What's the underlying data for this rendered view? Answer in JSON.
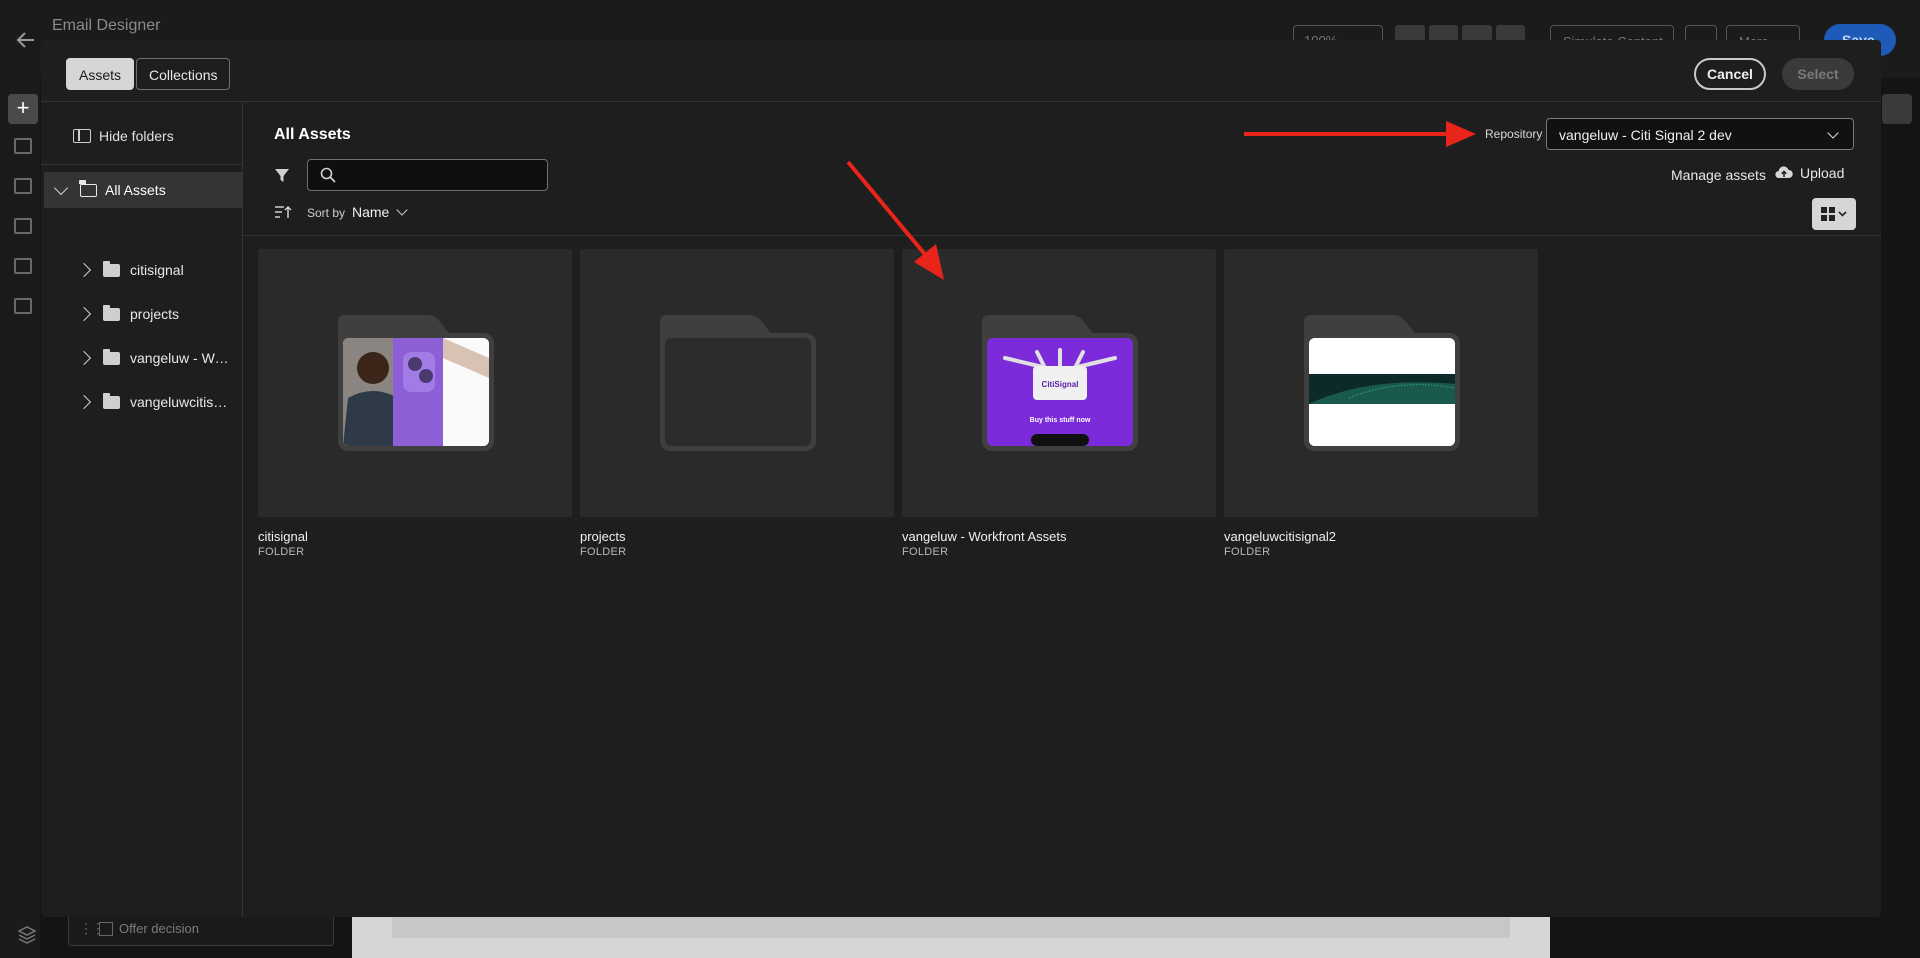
{
  "app": {
    "title": "Email Designer",
    "zoom": "100%",
    "simulate_label": "Simulate Content",
    "more_label": "More",
    "save_label": "Save",
    "offer_decision_label": "Offer decision"
  },
  "dialog": {
    "tabs": [
      {
        "label": "Assets",
        "active": true
      },
      {
        "label": "Collections",
        "active": false
      }
    ],
    "cancel_label": "Cancel",
    "select_label": "Select",
    "sidebar": {
      "hide_folders_label": "Hide folders",
      "root": {
        "label": "All Assets",
        "expanded": true
      },
      "items": [
        {
          "label": "citisignal"
        },
        {
          "label": "projects"
        },
        {
          "label": "vangeluw - Workfront Assets"
        },
        {
          "label": "vangeluwcitisignal2"
        }
      ]
    },
    "main": {
      "title": "All Assets",
      "search": {
        "placeholder": "",
        "value": ""
      },
      "sort_by_label": "Sort by",
      "sort_value": "Name",
      "repository_label": "Repository",
      "repository_value": "vangeluw - Citi Signal 2 dev",
      "manage_assets_label": "Manage assets",
      "upload_label": "Upload",
      "view_mode": "grid",
      "folders": [
        {
          "name": "citisignal",
          "type": "FOLDER",
          "preview": "phone-person"
        },
        {
          "name": "projects",
          "type": "FOLDER",
          "preview": "empty"
        },
        {
          "name": "vangeluw - Workfront Assets",
          "type": "FOLDER",
          "preview": "citisignal-email",
          "preview_text": "Buy this stuff now",
          "brand": "CitiSignal"
        },
        {
          "name": "vangeluwcitisignal2",
          "type": "FOLDER",
          "preview": "banner"
        }
      ]
    }
  },
  "colors": {
    "annotation_arrow": "#e8241b",
    "save_button": "#1e5bb8",
    "citisignal_purple": "#7b2bd9"
  }
}
